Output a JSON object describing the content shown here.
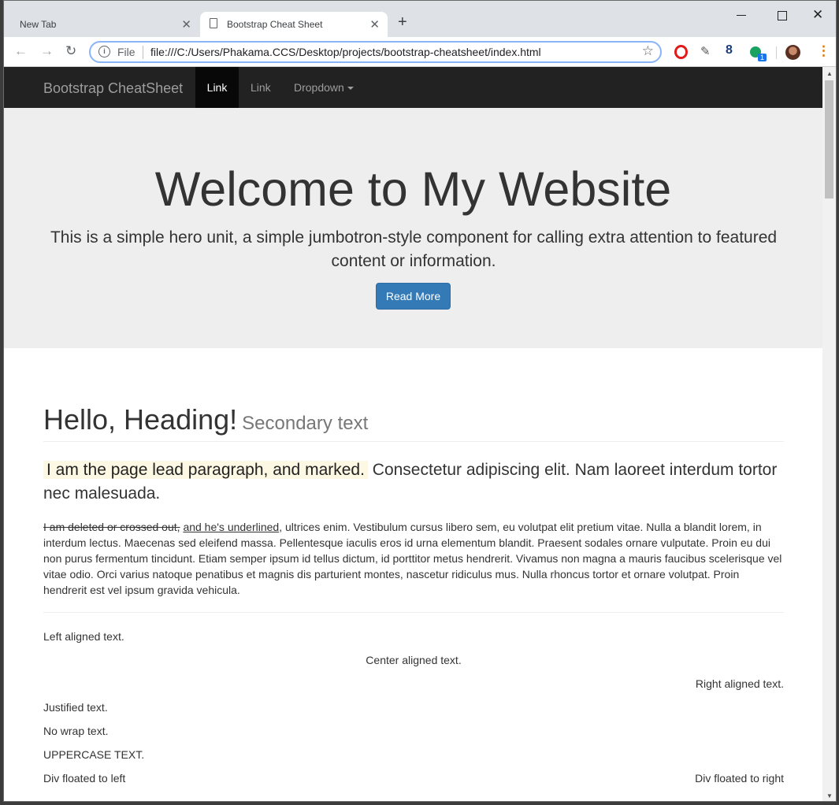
{
  "browser": {
    "tabs": [
      {
        "title": "New Tab",
        "active": false
      },
      {
        "title": "Bootstrap Cheat Sheet",
        "active": true
      }
    ],
    "new_tab": "+",
    "controls": {
      "close": "✕"
    },
    "omnibox": {
      "scheme_label": "File",
      "url": "file:///C:/Users/Phakama.CCS/Desktop/projects/bootstrap-cheatsheet/index.html"
    },
    "extension_badge": "1"
  },
  "navbar": {
    "brand": "Bootstrap CheatSheet",
    "links": [
      "Link",
      "Link"
    ],
    "dropdown": "Dropdown"
  },
  "jumbotron": {
    "title": "Welcome to My Website",
    "lead": "This is a simple hero unit, a simple jumbotron-style component for calling extra attention to featured content or information.",
    "button": "Read More"
  },
  "content": {
    "heading": "Hello, Heading!",
    "heading_small": "Secondary text",
    "lead_marked": "I am the page lead paragraph, and marked.",
    "lead_rest": "Consectetur adipiscing elit. Nam laoreet interdum tortor nec malesuada.",
    "para_deleted": "I am deleted or crossed out,",
    "para_underlined": "and he's underlined",
    "para_rest": ", ultrices enim. Vestibulum cursus libero sem, eu volutpat elit pretium vitae. Nulla a blandit lorem, in interdum lectus. Maecenas sed eleifend massa. Pellentesque iaculis eros id urna elementum blandit. Praesent sodales ornare vulputate. Proin eu dui non purus fermentum tincidunt. Etiam semper ipsum id tellus dictum, id porttitor metus hendrerit. Vivamus non magna a mauris faucibus scelerisque vel vitae odio. Orci varius natoque penatibus et magnis dis parturient montes, nascetur ridiculus mus. Nulla rhoncus tortor et ornare volutpat. Proin hendrerit est vel ipsum gravida vehicula.",
    "left_aligned": "Left aligned text.",
    "center_aligned": "Center aligned text.",
    "right_aligned": "Right aligned text.",
    "justified": "Justified text.",
    "nowrap": "No wrap text.",
    "uppercase": "UPPERCASE TEXT.",
    "float_left": "Div floated to left",
    "float_right": "Div floated to right"
  },
  "colors": {
    "navbar_bg": "#222222",
    "jumbotron_bg": "#eeeeee",
    "primary": "#337ab7",
    "mark_bg": "#fcf8e3"
  }
}
